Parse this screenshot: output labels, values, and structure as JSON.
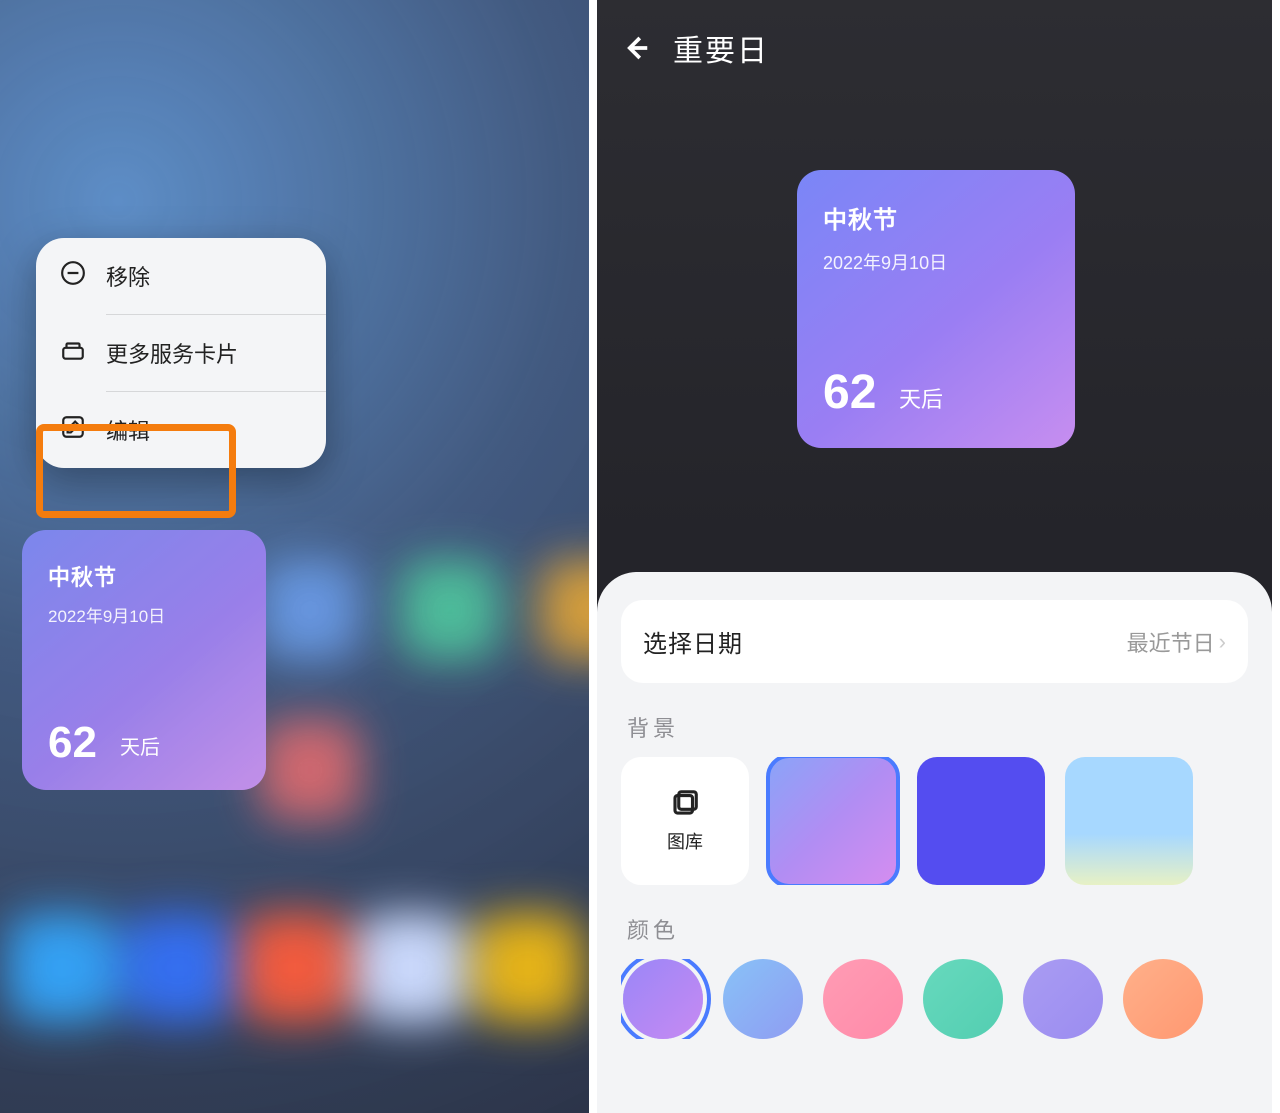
{
  "left_menu": {
    "remove": "移除",
    "more_cards": "更多服务卡片",
    "edit": "编辑"
  },
  "widget": {
    "event_title": "中秋节",
    "event_date": "2022年9月10日",
    "days_count": "62",
    "days_suffix": "天后"
  },
  "right_header": {
    "title": "重要日"
  },
  "sheet": {
    "date_label": "选择日期",
    "date_value": "最近节日",
    "section_bg": "背景",
    "section_color": "颜色",
    "gallery_label": "图库"
  }
}
